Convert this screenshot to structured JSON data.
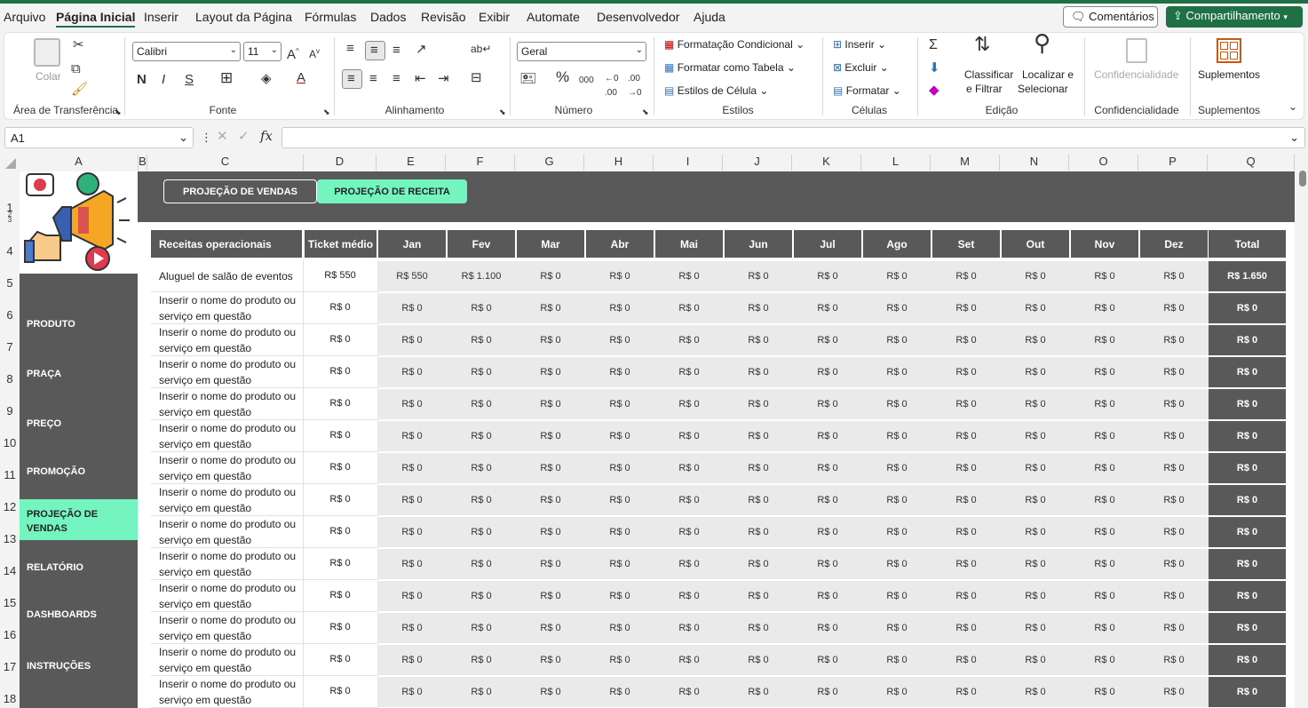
{
  "menu": {
    "items": [
      "Arquivo",
      "Página Inicial",
      "Inserir",
      "Layout da Página",
      "Fórmulas",
      "Dados",
      "Revisão",
      "Exibir",
      "Automate",
      "Desenvolvedor",
      "Ajuda"
    ],
    "comments_label": "Comentários",
    "share_label": "Compartilhamento"
  },
  "ribbon": {
    "clipboard": {
      "paste_label": "Colar",
      "group": "Área de Transferência"
    },
    "font": {
      "name": "Calibri",
      "size": "11",
      "group": "Fonte"
    },
    "alignment": {
      "group": "Alinhamento"
    },
    "number": {
      "format": "Geral",
      "group": "Número"
    },
    "styles": {
      "conditional": "Formatação Condicional",
      "format_table": "Formatar como Tabela",
      "cell_styles": "Estilos de Célula",
      "group": "Estilos"
    },
    "cells": {
      "insert": "Inserir",
      "delete": "Excluir",
      "format": "Formatar",
      "group": "Células"
    },
    "editing": {
      "sort_1": "Classificar",
      "sort_2": "e Filtrar",
      "find_1": "Localizar e",
      "find_2": "Selecionar",
      "group": "Edição"
    },
    "confidentiality": {
      "label": "Confidencialidade",
      "group": "Confidencialidade"
    },
    "addins": {
      "label": "Suplementos",
      "group": "Suplementos"
    }
  },
  "formula_bar": {
    "name_box": "A1",
    "fx": "fx",
    "value": ""
  },
  "columns": [
    "A",
    "B",
    "C",
    "D",
    "E",
    "F",
    "G",
    "H",
    "I",
    "J",
    "K",
    "L",
    "M",
    "N",
    "O",
    "P",
    "Q"
  ],
  "rows": [
    "1",
    "2",
    "3",
    "4",
    "5",
    "6",
    "7",
    "8",
    "9",
    "10",
    "11",
    "12",
    "13",
    "14",
    "15",
    "16",
    "17",
    "18"
  ],
  "tabs": {
    "sales": "PROJEÇÃO DE VENDAS",
    "revenue": "PROJEÇÃO DE RECEITA"
  },
  "nav": [
    {
      "label": "PRODUTO"
    },
    {
      "label": "PRAÇA"
    },
    {
      "label": "PREÇO"
    },
    {
      "label": "PROMOÇÃO"
    },
    {
      "label": "PROJEÇÃO DE VENDAS"
    },
    {
      "label": "RELATÓRIO"
    },
    {
      "label": "DASHBOARDS"
    },
    {
      "label": "INSTRUÇÕES"
    }
  ],
  "table": {
    "headers": [
      "Receitas operacionais",
      "Ticket médio",
      "Jan",
      "Fev",
      "Mar",
      "Abr",
      "Mai",
      "Jun",
      "Jul",
      "Ago",
      "Set",
      "Out",
      "Nov",
      "Dez",
      "Total"
    ],
    "rows": [
      {
        "name": "Aluguel de salão de eventos",
        "ticket": "R$ 550",
        "months": [
          "R$ 550",
          "R$ 1.100",
          "R$ 0",
          "R$ 0",
          "R$ 0",
          "R$ 0",
          "R$ 0",
          "R$ 0",
          "R$ 0",
          "R$ 0",
          "R$ 0",
          "R$ 0"
        ],
        "total": "R$ 1.650"
      },
      {
        "name": "Inserir o nome do produto ou serviço em questão",
        "ticket": "R$ 0",
        "months": [
          "R$ 0",
          "R$ 0",
          "R$ 0",
          "R$ 0",
          "R$ 0",
          "R$ 0",
          "R$ 0",
          "R$ 0",
          "R$ 0",
          "R$ 0",
          "R$ 0",
          "R$ 0"
        ],
        "total": "R$ 0"
      },
      {
        "name": "Inserir o nome do produto ou serviço em questão",
        "ticket": "R$ 0",
        "months": [
          "R$ 0",
          "R$ 0",
          "R$ 0",
          "R$ 0",
          "R$ 0",
          "R$ 0",
          "R$ 0",
          "R$ 0",
          "R$ 0",
          "R$ 0",
          "R$ 0",
          "R$ 0"
        ],
        "total": "R$ 0"
      },
      {
        "name": "Inserir o nome do produto ou serviço em questão",
        "ticket": "R$ 0",
        "months": [
          "R$ 0",
          "R$ 0",
          "R$ 0",
          "R$ 0",
          "R$ 0",
          "R$ 0",
          "R$ 0",
          "R$ 0",
          "R$ 0",
          "R$ 0",
          "R$ 0",
          "R$ 0"
        ],
        "total": "R$ 0"
      },
      {
        "name": "Inserir o nome do produto ou serviço em questão",
        "ticket": "R$ 0",
        "months": [
          "R$ 0",
          "R$ 0",
          "R$ 0",
          "R$ 0",
          "R$ 0",
          "R$ 0",
          "R$ 0",
          "R$ 0",
          "R$ 0",
          "R$ 0",
          "R$ 0",
          "R$ 0"
        ],
        "total": "R$ 0"
      },
      {
        "name": "Inserir o nome do produto ou serviço em questão",
        "ticket": "R$ 0",
        "months": [
          "R$ 0",
          "R$ 0",
          "R$ 0",
          "R$ 0",
          "R$ 0",
          "R$ 0",
          "R$ 0",
          "R$ 0",
          "R$ 0",
          "R$ 0",
          "R$ 0",
          "R$ 0"
        ],
        "total": "R$ 0"
      },
      {
        "name": "Inserir o nome do produto ou serviço em questão",
        "ticket": "R$ 0",
        "months": [
          "R$ 0",
          "R$ 0",
          "R$ 0",
          "R$ 0",
          "R$ 0",
          "R$ 0",
          "R$ 0",
          "R$ 0",
          "R$ 0",
          "R$ 0",
          "R$ 0",
          "R$ 0"
        ],
        "total": "R$ 0"
      },
      {
        "name": "Inserir o nome do produto ou serviço em questão",
        "ticket": "R$ 0",
        "months": [
          "R$ 0",
          "R$ 0",
          "R$ 0",
          "R$ 0",
          "R$ 0",
          "R$ 0",
          "R$ 0",
          "R$ 0",
          "R$ 0",
          "R$ 0",
          "R$ 0",
          "R$ 0"
        ],
        "total": "R$ 0"
      },
      {
        "name": "Inserir o nome do produto ou serviço em questão",
        "ticket": "R$ 0",
        "months": [
          "R$ 0",
          "R$ 0",
          "R$ 0",
          "R$ 0",
          "R$ 0",
          "R$ 0",
          "R$ 0",
          "R$ 0",
          "R$ 0",
          "R$ 0",
          "R$ 0",
          "R$ 0"
        ],
        "total": "R$ 0"
      },
      {
        "name": "Inserir o nome do produto ou serviço em questão",
        "ticket": "R$ 0",
        "months": [
          "R$ 0",
          "R$ 0",
          "R$ 0",
          "R$ 0",
          "R$ 0",
          "R$ 0",
          "R$ 0",
          "R$ 0",
          "R$ 0",
          "R$ 0",
          "R$ 0",
          "R$ 0"
        ],
        "total": "R$ 0"
      },
      {
        "name": "Inserir o nome do produto ou serviço em questão",
        "ticket": "R$ 0",
        "months": [
          "R$ 0",
          "R$ 0",
          "R$ 0",
          "R$ 0",
          "R$ 0",
          "R$ 0",
          "R$ 0",
          "R$ 0",
          "R$ 0",
          "R$ 0",
          "R$ 0",
          "R$ 0"
        ],
        "total": "R$ 0"
      },
      {
        "name": "Inserir o nome do produto ou serviço em questão",
        "ticket": "R$ 0",
        "months": [
          "R$ 0",
          "R$ 0",
          "R$ 0",
          "R$ 0",
          "R$ 0",
          "R$ 0",
          "R$ 0",
          "R$ 0",
          "R$ 0",
          "R$ 0",
          "R$ 0",
          "R$ 0"
        ],
        "total": "R$ 0"
      },
      {
        "name": "Inserir o nome do produto ou serviço em questão",
        "ticket": "R$ 0",
        "months": [
          "R$ 0",
          "R$ 0",
          "R$ 0",
          "R$ 0",
          "R$ 0",
          "R$ 0",
          "R$ 0",
          "R$ 0",
          "R$ 0",
          "R$ 0",
          "R$ 0",
          "R$ 0"
        ],
        "total": "R$ 0"
      },
      {
        "name": "Inserir o nome do produto ou serviço em questão",
        "ticket": "R$ 0",
        "months": [
          "R$ 0",
          "R$ 0",
          "R$ 0",
          "R$ 0",
          "R$ 0",
          "R$ 0",
          "R$ 0",
          "R$ 0",
          "R$ 0",
          "R$ 0",
          "R$ 0",
          "R$ 0"
        ],
        "total": "R$ 0"
      }
    ]
  },
  "colors": {
    "accent": "#74f5c0",
    "dark": "#595959",
    "brand": "#1f7145"
  }
}
